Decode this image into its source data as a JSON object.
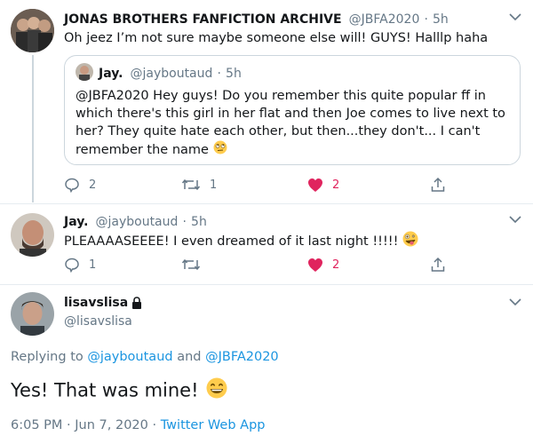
{
  "tweet1": {
    "display_name": "JONAS BROTHERS FANFICTION ARCHIVE",
    "handle": "@JBFA2020",
    "dot": "·",
    "time": "5h",
    "text": "Oh jeez I’m not sure maybe someone else will! GUYS! Halllp haha",
    "quote": {
      "display_name": "Jay.",
      "handle": "@jayboutaud",
      "dot": "·",
      "time": "5h",
      "text": "@JBFA2020 Hey guys! Do you remember this quite popular  ff in which there's this girl in her flat and then Joe comes to live next to her? They quite hate each other, but then...they don't... I can't remember the name",
      "emoji": "rolling-eyes-emoji"
    },
    "replies": "2",
    "retweets": "1",
    "likes": "2"
  },
  "tweet2": {
    "display_name": "Jay.",
    "handle": "@jayboutaud",
    "dot": "·",
    "time": "5h",
    "text": "PLEAAAASEEEE! I even dreamed of it last night !!!!!",
    "emoji": "zany-face-emoji",
    "replies": "1",
    "retweets": "",
    "likes": "2"
  },
  "tweet3": {
    "display_name": "lisavslisa",
    "handle": "@lisavslisa",
    "replying_prefix": "Replying to",
    "replying_user1": "@jayboutaud",
    "replying_and": "and",
    "replying_user2": "@JBFA2020",
    "text": "Yes! That was mine!",
    "emoji": "grinning-face-emoji",
    "time": "6:05 PM",
    "dot": "·",
    "date": "Jun 7, 2020",
    "source": "Twitter Web App"
  },
  "colors": {
    "text": "#14171a",
    "muted": "#657786",
    "link": "#1b95e0",
    "like": "#e0245e",
    "border": "#e6ecf0"
  }
}
